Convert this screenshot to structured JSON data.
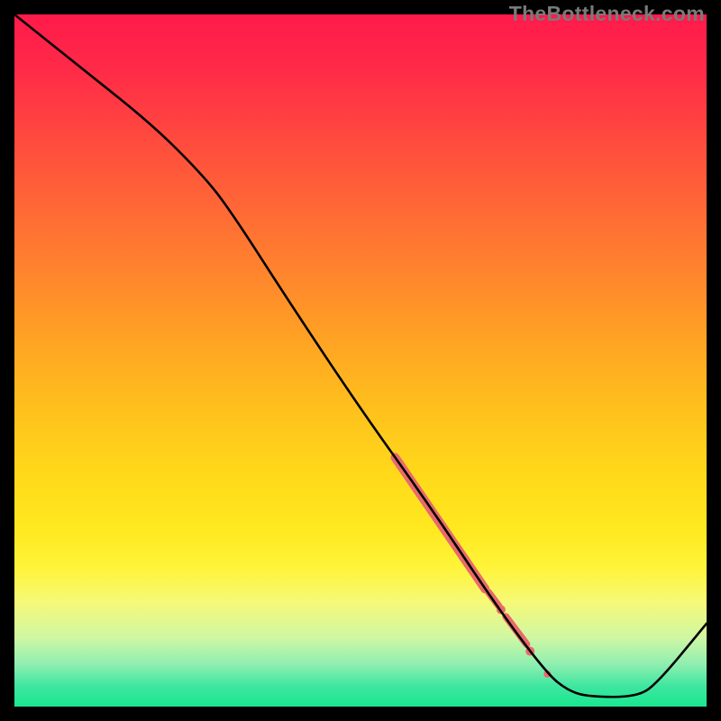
{
  "watermark": "TheBottleneck.com",
  "gradient": {
    "stops": [
      {
        "offset": 0.0,
        "color": "#ff1a4a"
      },
      {
        "offset": 0.08,
        "color": "#ff2a48"
      },
      {
        "offset": 0.18,
        "color": "#ff4a3e"
      },
      {
        "offset": 0.3,
        "color": "#ff6e34"
      },
      {
        "offset": 0.42,
        "color": "#ff9328"
      },
      {
        "offset": 0.54,
        "color": "#ffb81e"
      },
      {
        "offset": 0.66,
        "color": "#ffd81a"
      },
      {
        "offset": 0.74,
        "color": "#ffe81e"
      },
      {
        "offset": 0.8,
        "color": "#fff43a"
      },
      {
        "offset": 0.85,
        "color": "#f5f978"
      },
      {
        "offset": 0.9,
        "color": "#d0f7a4"
      },
      {
        "offset": 0.94,
        "color": "#8deeb0"
      },
      {
        "offset": 0.97,
        "color": "#3fe6a0"
      },
      {
        "offset": 1.0,
        "color": "#18e890"
      }
    ]
  },
  "chart_data": {
    "type": "line",
    "title": "",
    "xlabel": "",
    "ylabel": "",
    "x_range": [
      0,
      100
    ],
    "y_range": [
      0,
      100
    ],
    "series": [
      {
        "name": "curve",
        "color": "#000000",
        "points": [
          {
            "x": 0.0,
            "y": 100.0
          },
          {
            "x": 10.0,
            "y": 92.0
          },
          {
            "x": 20.0,
            "y": 84.0
          },
          {
            "x": 27.0,
            "y": 77.0
          },
          {
            "x": 31.0,
            "y": 72.0
          },
          {
            "x": 40.0,
            "y": 58.0
          },
          {
            "x": 50.0,
            "y": 43.0
          },
          {
            "x": 60.0,
            "y": 29.0
          },
          {
            "x": 70.0,
            "y": 14.0
          },
          {
            "x": 77.0,
            "y": 4.7
          },
          {
            "x": 80.0,
            "y": 2.3
          },
          {
            "x": 83.0,
            "y": 1.4
          },
          {
            "x": 90.0,
            "y": 1.4
          },
          {
            "x": 93.0,
            "y": 3.5
          },
          {
            "x": 100.0,
            "y": 12.0
          }
        ]
      }
    ],
    "cluster": {
      "color": "#e96a6a",
      "segments": [
        {
          "x0": 55.0,
          "y0": 36.0,
          "x1": 68.0,
          "y1": 17.0,
          "width": 10
        },
        {
          "x0": 68.5,
          "y0": 16.5,
          "x1": 70.0,
          "y1": 14.5,
          "width": 8
        },
        {
          "x0": 71.0,
          "y0": 13.0,
          "x1": 74.0,
          "y1": 9.0,
          "width": 8
        }
      ],
      "dots": [
        {
          "x": 70.3,
          "y": 14.0,
          "r": 5
        },
        {
          "x": 74.5,
          "y": 8.0,
          "r": 5
        },
        {
          "x": 77.0,
          "y": 4.7,
          "r": 4
        }
      ]
    }
  }
}
